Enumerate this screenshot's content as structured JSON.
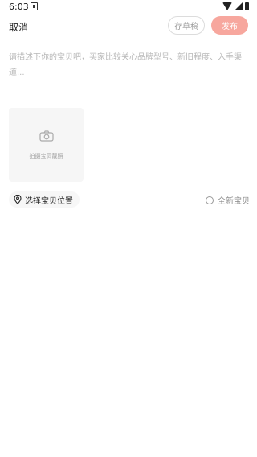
{
  "status_bar": {
    "time": "6:03",
    "icons": [
      "notification-icon",
      "wifi-icon",
      "signal-icon",
      "battery-icon"
    ]
  },
  "header": {
    "cancel_label": "取消",
    "draft_label": "存草稿",
    "publish_label": "发布"
  },
  "description": {
    "placeholder": "请描述下你的宝贝吧，买家比较关心品牌型号、新旧程度、入手渠道...",
    "value": ""
  },
  "photo": {
    "icon": "camera-icon",
    "label": "拍摄宝贝靓照"
  },
  "location": {
    "icon": "location-pin-icon",
    "label": "选择宝贝位置"
  },
  "new_item": {
    "label": "全新宝贝",
    "checked": false
  },
  "colors": {
    "accent": "#f7a79e",
    "placeholder": "#b8b8b8",
    "photo_bg": "#f6f6f6"
  }
}
